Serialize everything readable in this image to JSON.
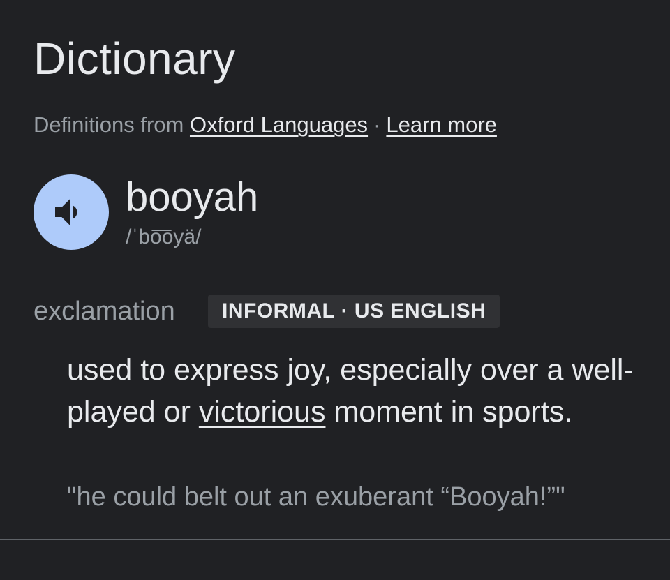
{
  "header": {
    "title": "Dictionary",
    "source_prefix": "Definitions from",
    "source_link": "Oxford Languages",
    "separator": "·",
    "learn_more": "Learn more"
  },
  "entry": {
    "audio_icon": "speaker-icon",
    "word": "booyah",
    "pronunciation": "/ˈbo͞oyä/",
    "part_of_speech": "exclamation",
    "tag": "INFORMAL · US ENGLISH",
    "definition": {
      "before_link": "used to express joy, especially over a well-played or ",
      "link_text": "victorious",
      "after_link": " moment in sports."
    },
    "example": "\"he could belt out an exuberant “Booyah!”\""
  },
  "colors": {
    "background": "#202124",
    "primary_text": "#e8eaed",
    "secondary_text": "#9aa0a6",
    "audio_button": "#aecbfa",
    "tag_background": "#303134",
    "divider": "#5f6368"
  }
}
